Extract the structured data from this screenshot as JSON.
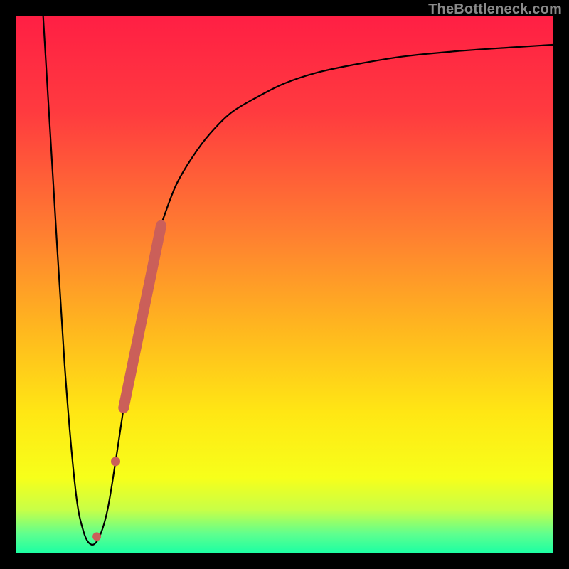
{
  "watermark": "TheBottleneck.com",
  "colors": {
    "black": "#000000",
    "curve": "#000000",
    "marker": "#cb5f59",
    "gradient_stops": [
      {
        "offset": 0.0,
        "color": "#ff1f44"
      },
      {
        "offset": 0.18,
        "color": "#ff3b3f"
      },
      {
        "offset": 0.4,
        "color": "#ff7d31"
      },
      {
        "offset": 0.58,
        "color": "#ffb61f"
      },
      {
        "offset": 0.74,
        "color": "#ffe714"
      },
      {
        "offset": 0.86,
        "color": "#f7ff1a"
      },
      {
        "offset": 0.92,
        "color": "#c8ff47"
      },
      {
        "offset": 0.965,
        "color": "#5fff8e"
      },
      {
        "offset": 1.0,
        "color": "#1dffa3"
      }
    ]
  },
  "chart_data": {
    "type": "line",
    "title": "",
    "xlabel": "",
    "ylabel": "",
    "xlim": [
      0,
      100
    ],
    "ylim": [
      0,
      100
    ],
    "series": [
      {
        "name": "bottleneck-curve",
        "x": [
          5,
          7,
          9,
          11,
          12.5,
          14,
          15.5,
          17,
          18.5,
          20,
          22,
          24,
          26,
          28,
          30,
          33,
          36,
          40,
          45,
          50,
          56,
          63,
          72,
          82,
          92,
          100
        ],
        "y": [
          100,
          67,
          35,
          12,
          4,
          1.5,
          3,
          8,
          17,
          27,
          40,
          50,
          58,
          64,
          69,
          74,
          78,
          82,
          85,
          87.5,
          89.5,
          91,
          92.5,
          93.5,
          94.2,
          94.7
        ]
      }
    ],
    "markers": [
      {
        "name": "highlight-segment",
        "kind": "thick-line",
        "x": [
          20,
          27
        ],
        "y": [
          27,
          61
        ]
      },
      {
        "name": "dot-1",
        "kind": "dot",
        "x": 18.5,
        "y": 17
      },
      {
        "name": "dot-2",
        "kind": "dot",
        "x": 15.0,
        "y": 3
      }
    ]
  }
}
